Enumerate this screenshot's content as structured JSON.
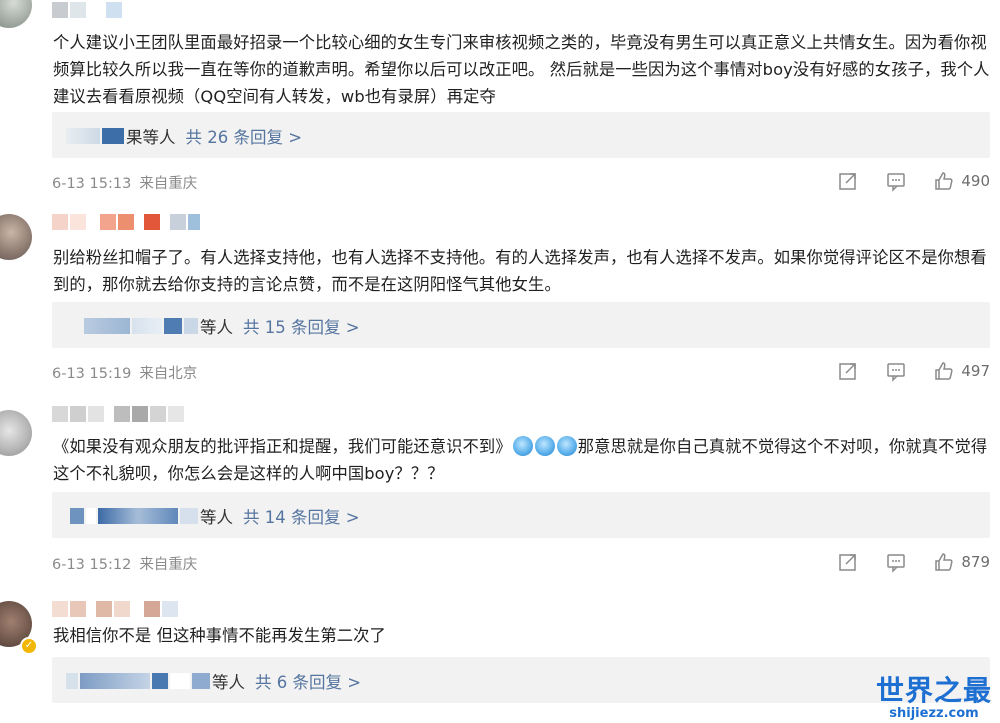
{
  "comments": [
    {
      "text": "个人建议小王团队里面最好招录一个比较心细的女生专门来审核视频之类的，毕竟没有男生可以真正意义上共情女生。因为看你视频算比较久所以我一直在等你的道歉声明。希望你以后可以改正吧。 然后就是一些因为这个事情对boy没有好感的女孩子，我个人建议去看看原视频（QQ空间有人转发，wb也有录屏）再定夺",
      "reply_visible_name": "果等人",
      "reply_count": "共 26 条回复 >",
      "time": "6-13 15:13",
      "location": "来自重庆",
      "likes": "490"
    },
    {
      "text": "别给粉丝扣帽子了。有人选择支持他，也有人选择不支持他。有的人选择发声，也有人选择不发声。如果你觉得评论区不是你想看到的，那你就去给你支持的言论点赞，而不是在这阴阳怪气其他女生。",
      "reply_visible_name": "等人",
      "reply_count": "共 15 条回复 >",
      "time": "6-13 15:19",
      "location": "来自北京",
      "likes": "497"
    },
    {
      "text_before": "《如果没有观众朋友的批评指正和提醒，我们可能还意识不到》",
      "text_after": "那意思就是你自己真就不觉得这个不对呗，你就真不觉得这个不礼貌呗，你怎么会是这样的人啊中国boy？？？",
      "reply_visible_name": "等人",
      "reply_count": "共 14 条回复 >",
      "time": "6-13 15:12",
      "location": "来自重庆",
      "likes": "879"
    },
    {
      "text": "我相信你不是 但这种事情不能再发生第二次了",
      "reply_visible_name": "等人",
      "reply_count": "共 6 条回复 >"
    }
  ],
  "icons": {
    "share": "share-icon",
    "comment": "comment-icon",
    "like": "thumbs-up-icon"
  },
  "watermark": {
    "title": "世界之最",
    "url": "shijiezz.com"
  },
  "colors": {
    "reply_link": "#5575a0",
    "meta_gray": "#8a8a8a",
    "reply_bg": "#f2f2f2",
    "watermark_blue": "#1d6fd1"
  }
}
